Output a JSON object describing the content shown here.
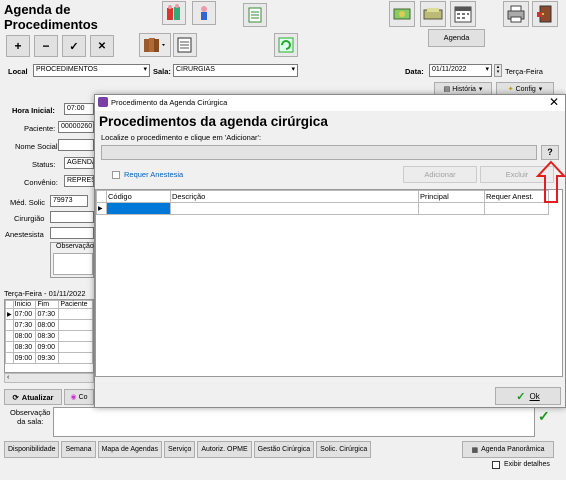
{
  "app": {
    "title_line1": "Agenda de",
    "title_line2": "Procedimentos",
    "agenda_button": "Agenda"
  },
  "toolbar": {
    "add": "+",
    "remove": "−",
    "confirm": "✓",
    "cancel": "✕"
  },
  "filters": {
    "local_label": "Local",
    "local_value": "PROCEDIMENTOS",
    "sala_label": "Sala:",
    "sala_value": "CIRURGIAS",
    "data_label": "Data:",
    "data_value": "01/11/2022",
    "weekday": "Terça-Feira",
    "historia": "História",
    "config": "Config"
  },
  "form": {
    "hora_inicial_label": "Hora Inicial:",
    "hora_inicial_value": "07:00",
    "paciente_label": "Paciente:",
    "paciente_value": "00000260",
    "nome_social_label": "Nome Social:",
    "status_label": "Status:",
    "status_value": "AGENDA",
    "convenio_label": "Convênio:",
    "convenio_value": "REPRES",
    "med_solic_label": "Méd. Solic",
    "med_solic_value": "79973",
    "cirurgiao_label": "Cirurgião",
    "anestesista_label": "Anestesista",
    "observacao_label": "Observação"
  },
  "schedule": {
    "header": "Terça-Feira - 01/11/2022",
    "columns": [
      "Inicio",
      "Fim",
      "Paciente"
    ],
    "rows": [
      [
        "07:00",
        "07:30",
        ""
      ],
      [
        "07:30",
        "08:00",
        ""
      ],
      [
        "08:00",
        "08:30",
        ""
      ],
      [
        "08:30",
        "09:00",
        ""
      ],
      [
        "09:00",
        "09:30",
        ""
      ]
    ]
  },
  "bottom": {
    "atualizar": "Atualizar",
    "cor": "Co",
    "observacao_sala": "Observação\nda sala:",
    "tabs": [
      "Disponibilidade",
      "Semana",
      "Mapa de Agendas",
      "Serviço",
      "Autoriz. OPME",
      "Gestão Cirúrgica",
      "Solic. Cirúrgica"
    ],
    "agenda_panoramica": "Agenda Panorâmica",
    "exibir_detalhes": "Exibir detalhes"
  },
  "dialog": {
    "window_title": "Procedimento da Agenda Cirúrgica",
    "heading": "Procedimentos da agenda cirúrgica",
    "instruction": "Localize o procedimento e clique em 'Adicionar':",
    "search_value": "",
    "help_button": "?",
    "requer_anestesia": "Requer Anestesia",
    "adicionar": "Adicionar",
    "excluir": "Excluir",
    "columns": [
      "Código",
      "Descrição",
      "Principal",
      "Requer Anest."
    ],
    "ok": "Ok"
  },
  "colors": {
    "annotation_arrow": "#e0201c",
    "selection": "#0078d7",
    "ok_check": "#1a9a1a"
  }
}
